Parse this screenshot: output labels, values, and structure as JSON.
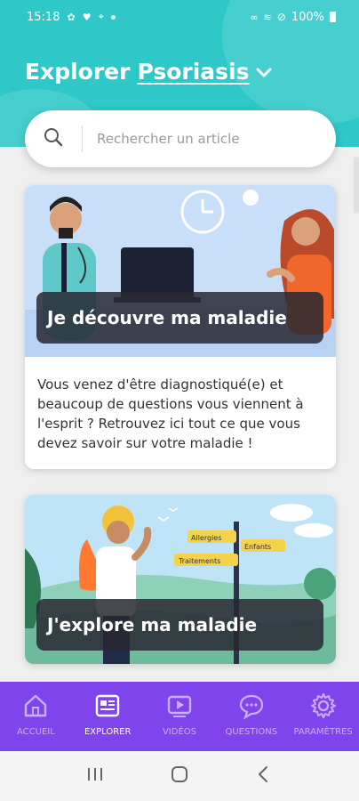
{
  "status_bar": {
    "time": "15:18",
    "battery": "100%"
  },
  "header": {
    "title": "Explorer",
    "topic": "Psoriasis"
  },
  "search": {
    "placeholder": "Rechercher un article"
  },
  "cards": [
    {
      "title": "Je découvre ma maladie",
      "description": "Vous venez d'être diagnostiqué(e) et beaucoup de questions vous viennent à l'esprit ? Retrouvez ici tout ce que vous devez savoir sur votre maladie !"
    },
    {
      "title": "J'explore ma maladie",
      "signs": [
        "Allergies",
        "Enfants",
        "Traitements"
      ]
    }
  ],
  "nav": [
    {
      "label": "ACCUEIL",
      "icon": "home-icon",
      "active": false
    },
    {
      "label": "EXPLORER",
      "icon": "explore-icon",
      "active": true
    },
    {
      "label": "VIDÉOS",
      "icon": "video-icon",
      "active": false
    },
    {
      "label": "QUESTIONS",
      "icon": "chat-icon",
      "active": false
    },
    {
      "label": "PARAMÈTRES",
      "icon": "gear-icon",
      "active": false
    }
  ],
  "colors": {
    "header": "#2ec8c8",
    "nav": "#8044ec",
    "card_label_bg": "#28283a"
  }
}
